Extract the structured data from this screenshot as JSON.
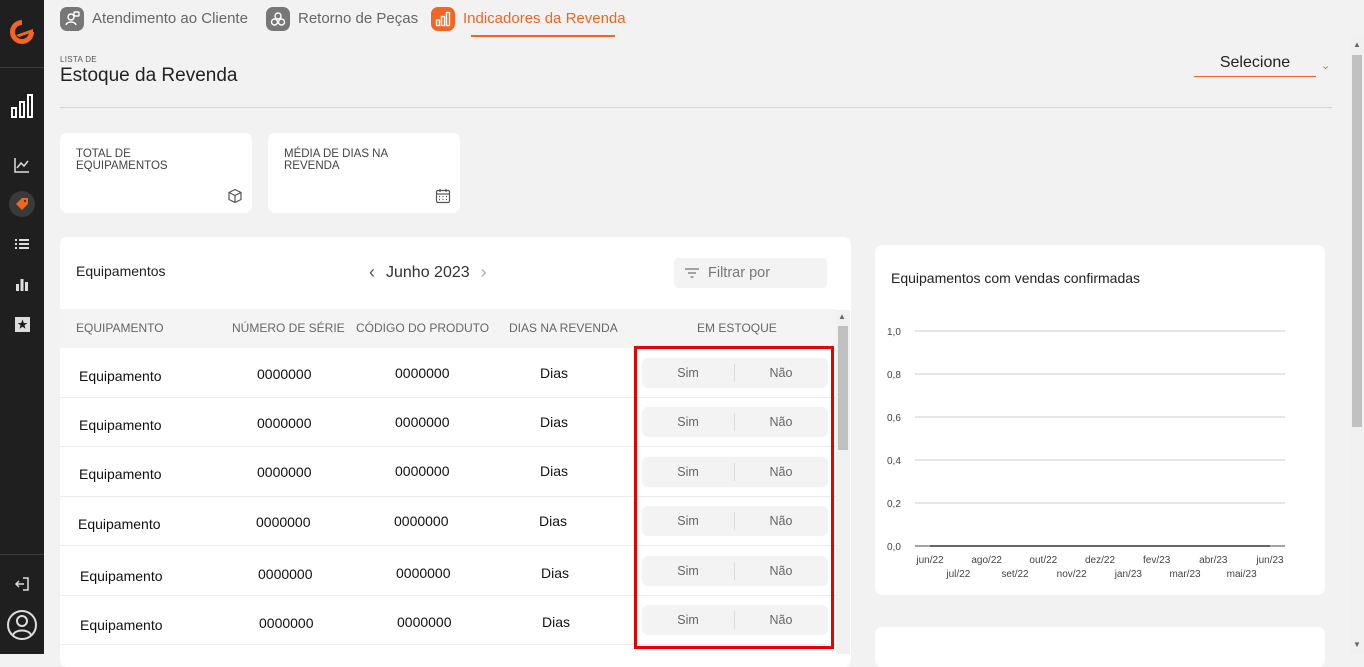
{
  "tabs": [
    {
      "label": "Atendimento ao Cliente",
      "icon": "headset-user-icon",
      "active": false
    },
    {
      "label": "Retorno de Peças",
      "icon": "gears-icon",
      "active": false
    },
    {
      "label": "Indicadores da Revenda",
      "icon": "bar-chart-icon",
      "active": true
    }
  ],
  "sidebar": {
    "logo": "brand-logo-icon",
    "items": [
      "bar-chart-icon",
      "line-chart-icon",
      "tag-icon",
      "list-icon",
      "column-chart-icon",
      "star-icon"
    ],
    "active_item": "tag-icon",
    "footer": [
      "logout-icon",
      "user-avatar-icon"
    ]
  },
  "header": {
    "label": "LISTA DE",
    "title": "Estoque da Revenda",
    "select_value": "Selecione"
  },
  "kpis": [
    {
      "label": "TOTAL DE EQUIPAMENTOS",
      "icon": "box-icon"
    },
    {
      "label": "MÉDIA DE DIAS NA REVENDA",
      "icon": "calendar-icon"
    }
  ],
  "equipments": {
    "title": "Equipamentos",
    "month": "Junho 2023",
    "filter_placeholder": "Filtrar por",
    "columns": [
      "EQUIPAMENTO",
      "NÚMERO DE SÉRIE",
      "CÓDIGO DO PRODUTO",
      "DIAS NA REVENDA",
      "EM ESTOQUE"
    ],
    "rows": [
      {
        "equipamento": "Equipamento",
        "serie": "0000000",
        "codigo": "0000000",
        "dias": "Dias",
        "sim": "Sim",
        "nao": "Não"
      },
      {
        "equipamento": "Equipamento",
        "serie": "0000000",
        "codigo": "0000000",
        "dias": "Dias",
        "sim": "Sim",
        "nao": "Não"
      },
      {
        "equipamento": "Equipamento",
        "serie": "0000000",
        "codigo": "0000000",
        "dias": "Dias",
        "sim": "Sim",
        "nao": "Não"
      },
      {
        "equipamento": "Equipamento",
        "serie": "0000000",
        "codigo": "0000000",
        "dias": "Dias",
        "sim": "Sim",
        "nao": "Não"
      },
      {
        "equipamento": "Equipamento",
        "serie": "0000000",
        "codigo": "0000000",
        "dias": "Dias",
        "sim": "Sim",
        "nao": "Não"
      },
      {
        "equipamento": "Equipamento",
        "serie": "0000000",
        "codigo": "0000000",
        "dias": "Dias",
        "sim": "Sim",
        "nao": "Não"
      }
    ]
  },
  "sales_chart": {
    "title": "Equipamentos com vendas confirmadas"
  },
  "chart_data": {
    "type": "line",
    "title": "Equipamentos com vendas confirmadas",
    "x": [
      "jun/22",
      "jul/22",
      "ago/22",
      "set/22",
      "out/22",
      "nov/22",
      "dez/22",
      "jan/23",
      "fev/23",
      "mar/23",
      "abr/23",
      "mai/23",
      "jun/23"
    ],
    "series": [
      {
        "values": [
          0,
          0,
          0,
          0,
          0,
          0,
          0,
          0,
          0,
          0,
          0,
          0,
          0
        ]
      }
    ],
    "yticks": [
      "0,0",
      "0,2",
      "0,4",
      "0,6",
      "0,8",
      "1,0"
    ],
    "ylim": [
      0,
      1
    ],
    "grid": true,
    "xlabel": "",
    "ylabel": ""
  },
  "colors": {
    "accent": "#f26522",
    "sidebar": "#1f1f1f",
    "highlight": "#e60000"
  }
}
